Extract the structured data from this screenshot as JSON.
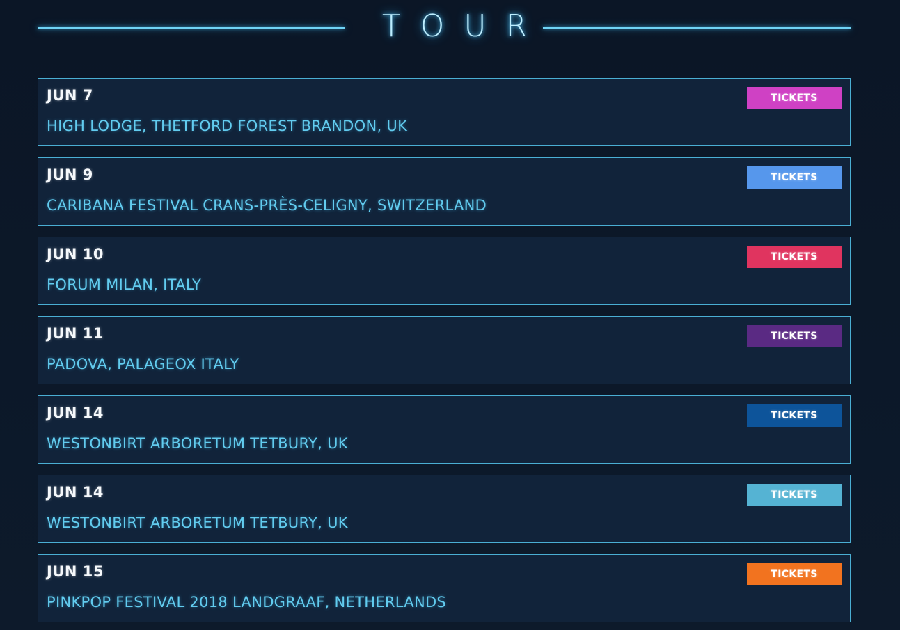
{
  "header": {
    "title": "TOUR"
  },
  "tour": {
    "rows": [
      {
        "date": "JUN 7",
        "venue": "HIGH LODGE, THETFORD FOREST BRANDON, UK",
        "ticket_label": "TICKETS",
        "ticket_color": "#cf41c4"
      },
      {
        "date": "JUN 9",
        "venue": "CARIBANA FESTIVAL CRANS-PRÈS-CELIGNY, SWITZERLAND",
        "ticket_label": "TICKETS",
        "ticket_color": "#5697ec"
      },
      {
        "date": "JUN 10",
        "venue": "FORUM MILAN, ITALY",
        "ticket_label": "TICKETS",
        "ticket_color": "#e0345f"
      },
      {
        "date": "JUN 11",
        "venue": "PADOVA, PALAGEOX ITALY",
        "ticket_label": "TICKETS",
        "ticket_color": "#5a2a83"
      },
      {
        "date": "JUN 14",
        "venue": "WESTONBIRT ARBORETUM TETBURY, UK",
        "ticket_label": "TICKETS",
        "ticket_color": "#0d549a"
      },
      {
        "date": "JUN 14",
        "venue": "WESTONBIRT ARBORETUM TETBURY, UK",
        "ticket_label": "TICKETS",
        "ticket_color": "#55b3d3"
      },
      {
        "date": "JUN 15",
        "venue": "PINKPOP FESTIVAL 2018 LANDGRAAF, NETHERLANDS",
        "ticket_label": "TICKETS",
        "ticket_color": "#f2731f"
      }
    ]
  }
}
